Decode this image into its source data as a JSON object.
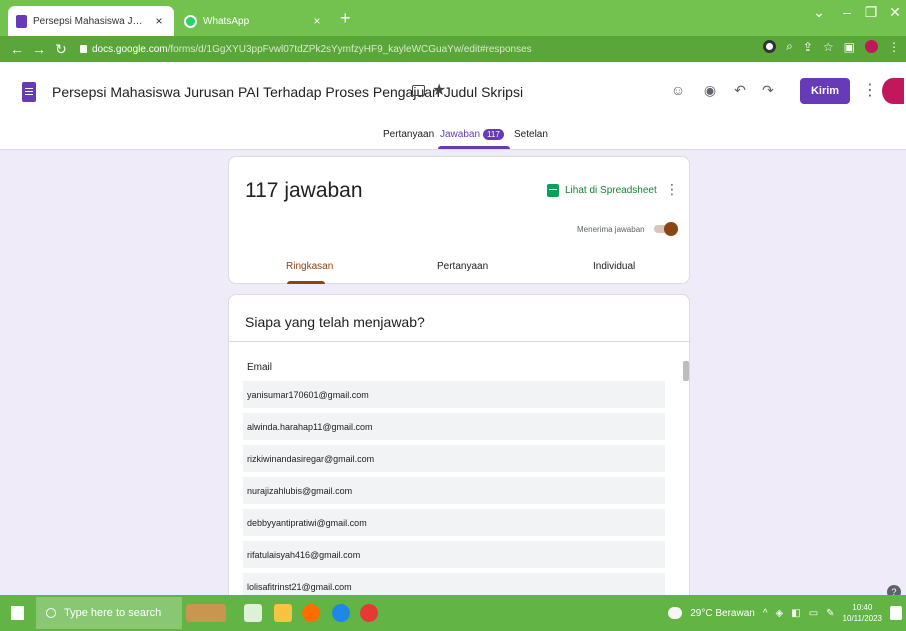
{
  "browser": {
    "tabs": [
      {
        "title": "Persepsi Mahasiswa Jurusan PAI",
        "close": "×"
      },
      {
        "title": "WhatsApp",
        "close": "×"
      }
    ],
    "new_tab": "+",
    "url_host": "docs.google.com",
    "url_path": "/forms/d/1GgXYU3ppFvwl07tdZPk2sYymfzyHF9_kayleWCGuaYw/edit#responses"
  },
  "form": {
    "title": "Persepsi Mahasiswa Jurusan PAI Terhadap Proses Pengajuan Judul Skripsi",
    "send_button": "Kirim",
    "tabs": [
      {
        "label": "Pertanyaan"
      },
      {
        "label": "Jawaban",
        "badge": "117"
      },
      {
        "label": "Setelan"
      }
    ]
  },
  "summary": {
    "count_label": "117 jawaban",
    "sheet_link": "Lihat di Spreadsheet",
    "accepting_label": "Menerima jawaban",
    "accepting": true,
    "subtabs": [
      "Ringkasan",
      "Pertanyaan",
      "Individual"
    ]
  },
  "responders": {
    "title": "Siapa yang telah menjawab?",
    "column": "Email",
    "emails": [
      "yanisumar170601@gmail.com",
      "alwinda.harahap11@gmail.com",
      "rizkiwinandasiregar@gmail.com",
      "nurajizahlubis@gmail.com",
      "debbyyantipratiwi@gmail.com",
      "rifatulaisyah416@gmail.com",
      "lolisafitrinst21@gmail.com"
    ]
  },
  "taskbar": {
    "search_placeholder": "Type here to search",
    "weather": "29°C Berawan",
    "time": "10:40",
    "date": "10/11/2023"
  },
  "colors": {
    "form_accent": "#673ab7",
    "chrome": "#73c24f",
    "toggle": "#8b4513"
  }
}
